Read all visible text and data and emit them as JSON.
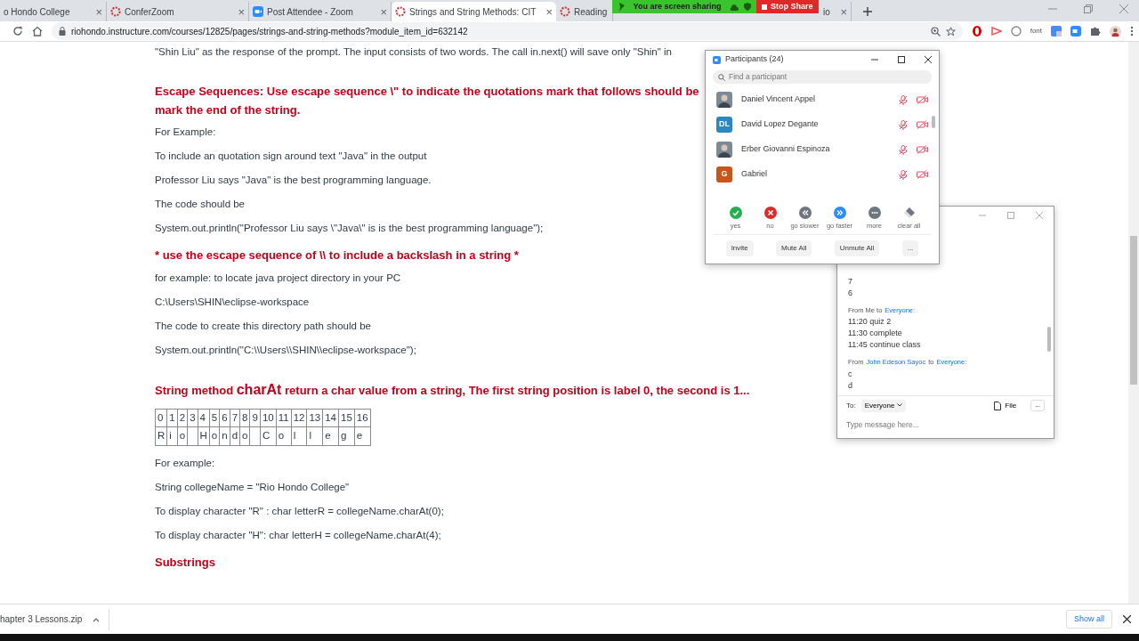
{
  "browser": {
    "tabs": [
      {
        "title": "o Hondo College",
        "selected": false,
        "close": "×"
      },
      {
        "title": "ConferZoom",
        "selected": false,
        "close": "×"
      },
      {
        "title": "Post Attendee - Zoom",
        "selected": false,
        "close": "×"
      },
      {
        "title": "Strings and String Methods: CIT",
        "selected": true,
        "close": "×"
      },
      {
        "title": "Reading",
        "selected": false
      },
      {
        "title": "io",
        "selected": false,
        "close": "×"
      }
    ],
    "share_bar": {
      "text": "You are screen sharing",
      "button": "Stop Share"
    },
    "url": "riohondo.instructure.com/courses/12825/pages/strings-and-string-methods?module_item_id=632142",
    "extension_label": "font"
  },
  "page": {
    "lines": [
      {
        "kind": "text",
        "text": "\"Shin Liu\"   as the response of the prompt.  The input consists of two words.   The call  in.next() will save only \"Shin\" in"
      },
      {
        "kind": "section",
        "lines": [
          "Escape Sequences:  Use escape sequence \\\" to  indicate the quotations mark that follows should be",
          "mark the end of the string."
        ]
      },
      {
        "kind": "text",
        "text": "For Example:"
      },
      {
        "kind": "text",
        "text": "To  include an quotation sign around text \"Java\" in the output"
      },
      {
        "kind": "text",
        "text": "Professor Liu says \"Java\" is  the best programming language."
      },
      {
        "kind": "text",
        "text": "The code should be"
      },
      {
        "kind": "text",
        "text": "System.out.println(\"Professor Liu says \\\"Java\\\" is is the best programming language\");"
      },
      {
        "kind": "subheading",
        "lines": [
          "*  use the escape sequence of \\\\ to include a backslash in a string *"
        ]
      },
      {
        "kind": "text",
        "text": "for example: to locate java project directory in your PC"
      },
      {
        "kind": "text",
        "text": "C:\\Users\\SHIN\\eclipse-workspace"
      },
      {
        "kind": "text",
        "text": "The code to create this directory path should be"
      },
      {
        "kind": "text",
        "text": "System.out.println(\"C:\\\\Users\\\\SHIN\\\\eclipse-workspace\");"
      },
      {
        "kind": "section-mixed",
        "before": "String method ",
        "word": "charAt",
        "after": " return a char value from a string,  The first string position is label 0, the second is 1..."
      },
      {
        "kind": "table",
        "indices": [
          "0",
          "1",
          "2",
          "3",
          "4",
          "5",
          "6",
          "7",
          "8",
          "9",
          "10",
          "11",
          "12",
          "13",
          "14",
          "15",
          "16"
        ],
        "letters": [
          {
            "text": "R",
            "blank": false
          },
          {
            "text": "i",
            "blank": false
          },
          {
            "text": "o",
            "blank": false
          },
          {
            "blank": true
          },
          {
            "text": "H",
            "blank": false
          },
          {
            "text": "o",
            "blank": false
          },
          {
            "text": "n",
            "blank": false
          },
          {
            "text": "d",
            "blank": false
          },
          {
            "text": "o",
            "blank": false
          },
          {
            "blank": true
          },
          {
            "text": "C",
            "blank": false
          },
          {
            "text": "o",
            "blank": false
          },
          {
            "text": "l",
            "blank": false
          },
          {
            "text": "l",
            "blank": false
          },
          {
            "text": "e",
            "blank": false
          },
          {
            "text": "g",
            "blank": false
          },
          {
            "text": "e",
            "blank": false
          }
        ]
      },
      {
        "kind": "text",
        "text": "For example:"
      },
      {
        "kind": "text",
        "text": "String collegeName = \"Rio Hondo College\""
      },
      {
        "kind": "text",
        "text": "To display  character  \"R\" :  char letterR = collegeName.charAt(0);"
      },
      {
        "kind": "text",
        "text": "To display  character  \"H\":  char letterH = collegeName.charAt(4);"
      },
      {
        "kind": "subheading",
        "lines": [
          "Substrings"
        ]
      }
    ]
  },
  "participants": {
    "title": "Participants (24)",
    "search_placeholder": "Find a participant",
    "people": [
      {
        "name": "Daniel Vincent Appel",
        "kind": "photo",
        "mic_muted": true,
        "video_off": true
      },
      {
        "name": "David Lopez Degante",
        "kind": "initials",
        "initials": "DL",
        "color": "#2e86c1",
        "mic_muted": true,
        "video_off": true
      },
      {
        "name": "Erber Giovanni Espinoza",
        "kind": "photo",
        "mic_muted": true,
        "video_off": true
      },
      {
        "name": "Gabriel",
        "kind": "initials",
        "initials": "G",
        "color": "#c8561b",
        "mic_muted": true,
        "video_off": true
      }
    ],
    "reactions": [
      {
        "kind": "yes",
        "label": "yes",
        "color": "#23b14d"
      },
      {
        "kind": "no",
        "label": "no",
        "color": "#e02828"
      },
      {
        "kind": "slower",
        "label": "go slower",
        "color": "#6e7680"
      },
      {
        "kind": "faster",
        "label": "go faster",
        "color": "#2d8cff"
      },
      {
        "kind": "more",
        "label": "more",
        "color": "#6e7680"
      },
      {
        "kind": "clear",
        "label": "clear all",
        "color": "#747487"
      }
    ],
    "buttons": [
      "Invite",
      "Mute All",
      "Unmute All",
      "..."
    ]
  },
  "chat": {
    "messages": [
      {
        "lines": [
          "7",
          "6"
        ]
      },
      {
        "header": [
          {
            "text": "From Me to",
            "link": false
          },
          {
            "text": "Everyone:",
            "link": true
          }
        ],
        "lines": [
          "11:20  quiz 2",
          "11:30 complete",
          "11:45 continue class"
        ]
      },
      {
        "header": [
          {
            "text": "From",
            "link": false
          },
          {
            "text": "John Edeson Sayoc",
            "link": true
          },
          {
            "text": "to",
            "link": false
          },
          {
            "text": "Everyone:",
            "link": true
          }
        ],
        "lines": [
          "c",
          "d"
        ]
      }
    ],
    "to_label": "To:",
    "recipient": "Everyone",
    "file_label": "File",
    "more": "...",
    "placeholder": "Type message here..."
  },
  "downloads": {
    "file": "hapter 3 Lessons.zip",
    "show_all": "Show all"
  }
}
